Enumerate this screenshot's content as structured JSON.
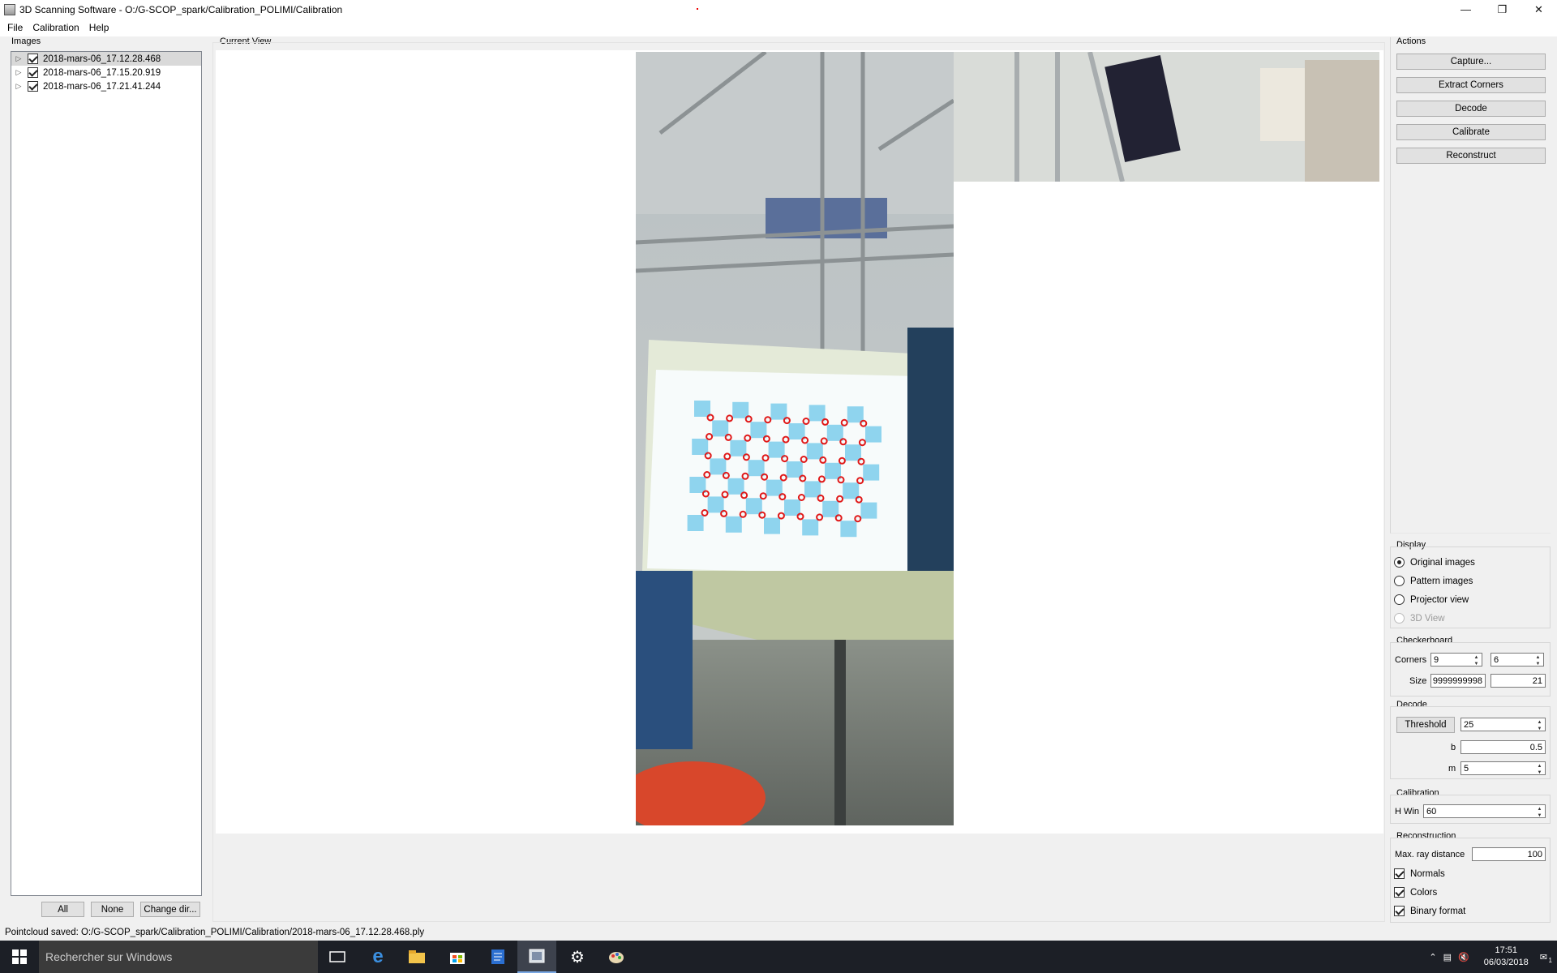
{
  "window": {
    "title": "3D Scanning Software - O:/G-SCOP_spark/Calibration_POLIMI/Calibration"
  },
  "menu": [
    "File",
    "Calibration",
    "Help"
  ],
  "images_panel": {
    "title": "Images",
    "items": [
      {
        "label": "2018-mars-06_17.12.28.468",
        "checked": true,
        "selected": true
      },
      {
        "label": "2018-mars-06_17.15.20.919",
        "checked": true,
        "selected": false
      },
      {
        "label": "2018-mars-06_17.21.41.244",
        "checked": true,
        "selected": false
      }
    ],
    "buttons": {
      "all": "All",
      "none": "None",
      "change_dir": "Change dir..."
    }
  },
  "view": {
    "title": "Current View"
  },
  "actions": {
    "title": "Actions",
    "buttons": [
      "Capture...",
      "Extract Corners",
      "Decode",
      "Calibrate",
      "Reconstruct"
    ]
  },
  "display": {
    "title": "Display",
    "options": [
      {
        "label": "Original images",
        "selected": true,
        "enabled": true
      },
      {
        "label": "Pattern images",
        "selected": false,
        "enabled": true
      },
      {
        "label": "Projector view",
        "selected": false,
        "enabled": true
      },
      {
        "label": "3D View",
        "selected": false,
        "enabled": false
      }
    ]
  },
  "checkboard": {
    "title": "Checkerboard",
    "corners_label": "Corners",
    "corners_x": "9",
    "corners_y": "6",
    "size_label": "Size",
    "size_x": "9999999998",
    "size_y": "21"
  },
  "decode": {
    "title": "Decode",
    "threshold_button": "Threshold",
    "threshold": "25",
    "b_label": "b",
    "b": "0.5",
    "m_label": "m",
    "m": "5"
  },
  "calibration": {
    "title": "Calibration",
    "hwin_label": "H Win",
    "hwin": "60"
  },
  "reconstruction": {
    "title": "Reconstruction",
    "max_ray_label": "Max. ray distance",
    "max_ray": "100",
    "checks": [
      {
        "label": "Normals",
        "checked": true
      },
      {
        "label": "Colors",
        "checked": true
      },
      {
        "label": "Binary format",
        "checked": true
      }
    ]
  },
  "status": "Pointcloud saved: O:/G-SCOP_spark/Calibration_POLIMI/Calibration/2018-mars-06_17.12.28.468.ply",
  "taskbar": {
    "search_placeholder": "Rechercher sur Windows",
    "time": "17:51",
    "date": "06/03/2018",
    "notification_count": "1"
  },
  "colors": {
    "accent": "#0078d7",
    "corner_marker": "#e01818",
    "checker_square": "#8fd4ee"
  }
}
